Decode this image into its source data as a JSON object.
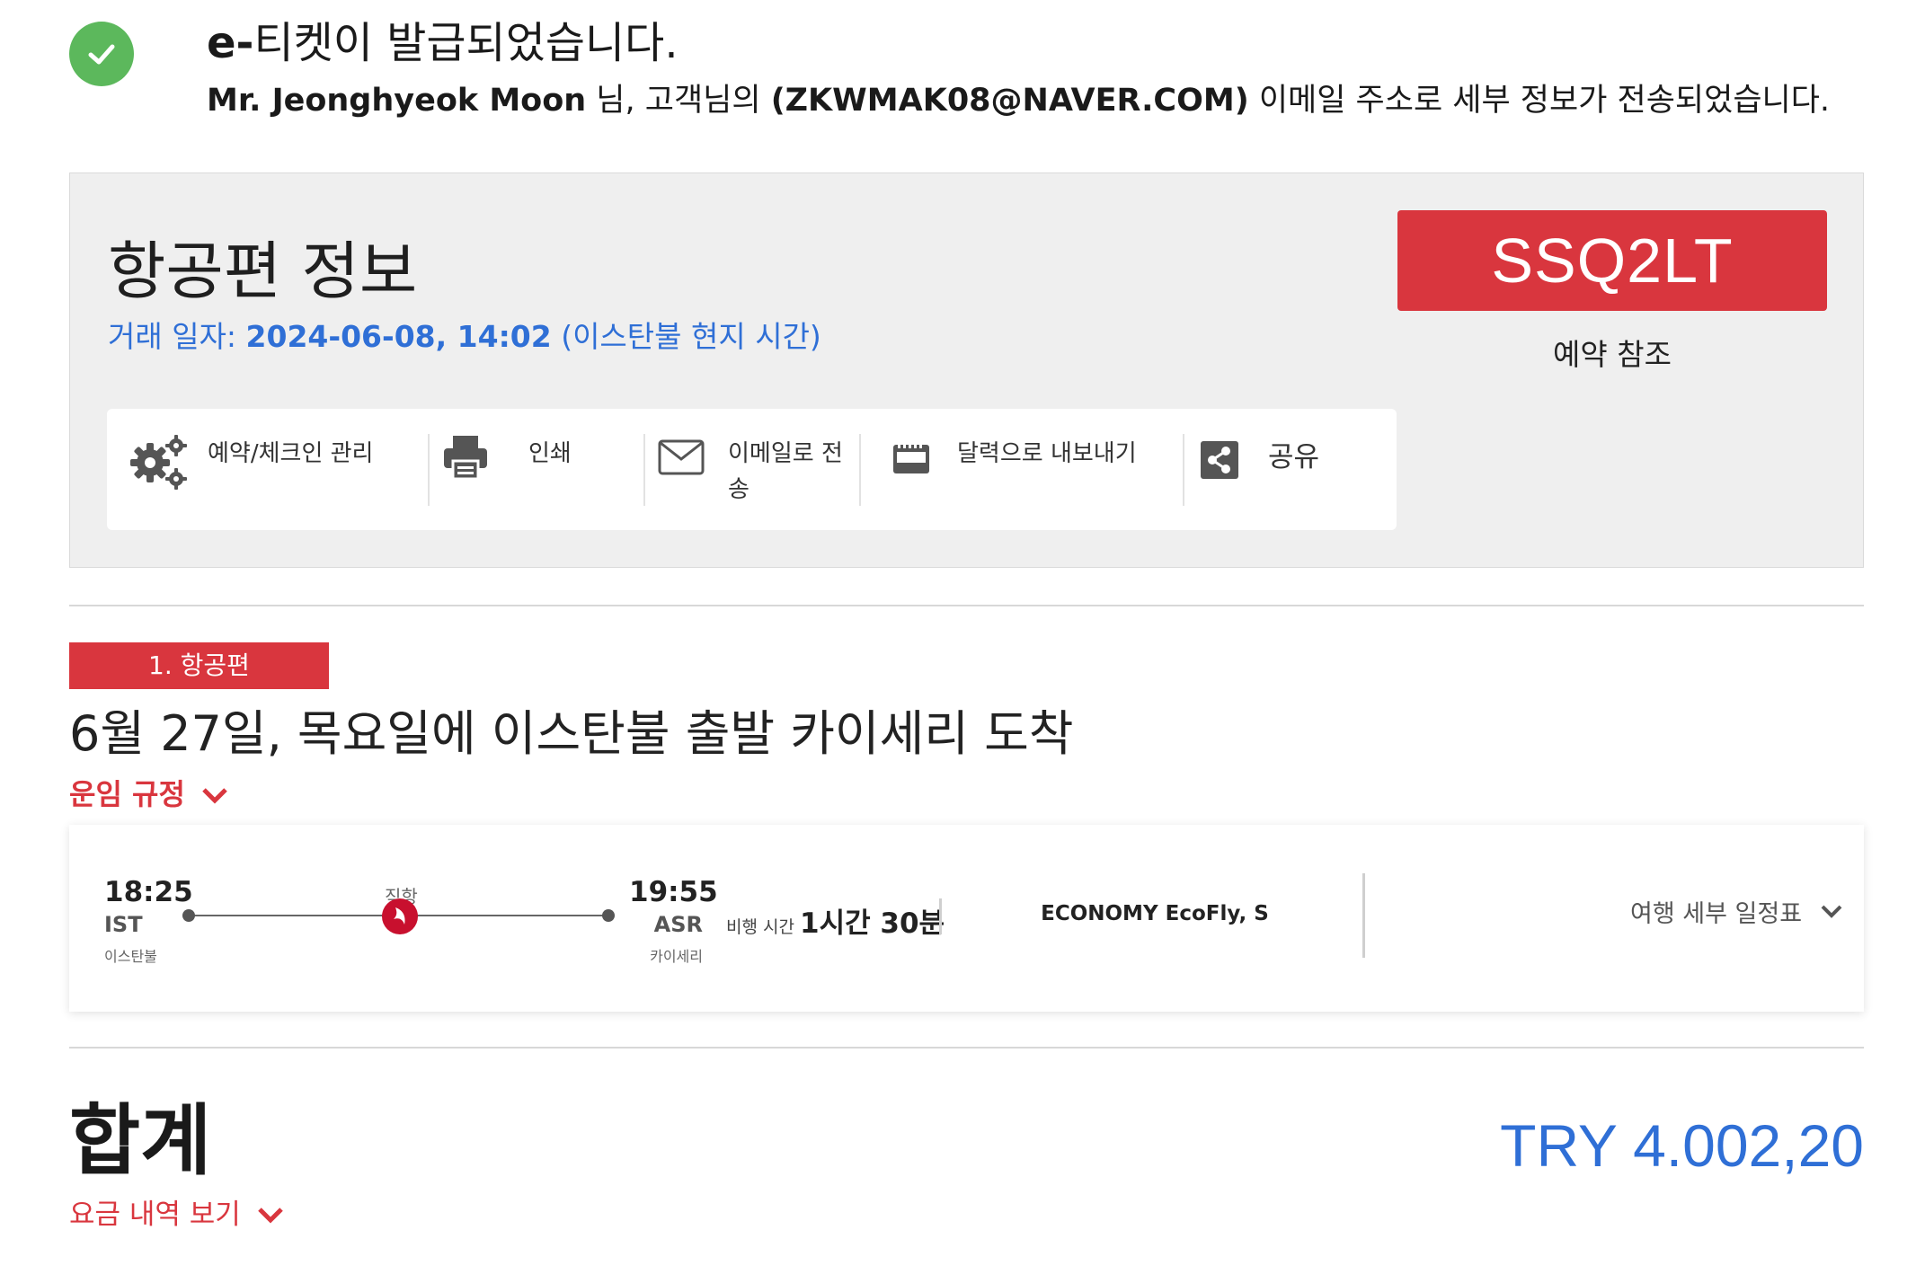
{
  "confirmation": {
    "title_bold": "e-",
    "title_rest": "티켓이 발급되었습니다.",
    "passenger_name": "Mr. Jeonghyeok Moon",
    "msg_mid": " 님, 고객님의 ",
    "email": "(ZKWMAK08@NAVER.COM)",
    "msg_end": " 이메일 주소로 세부 정보가 전송되었습니다."
  },
  "flight_info": {
    "title": "항공편 정보",
    "trans_label": "거래 일자: ",
    "trans_datetime": "2024-06-08, 14:02",
    "trans_tz": " (이스탄불 현지 시간)",
    "pnr": "SSQ2LT",
    "pnr_label": "예약 참조"
  },
  "actions": {
    "manage": "예약/체크인 관리",
    "print": "인쇄",
    "email": "이메일로 전 송",
    "calendar": "달력으로 내보내기",
    "share": "공유"
  },
  "segment": {
    "badge": "1. 항공편",
    "route_title": "6월 27일, 목요일에 이스탄불 출발 카이세리 도착",
    "fare_rules": "운임 규정",
    "dep_time": "18:25",
    "dep_code": "IST",
    "dep_city": "이스탄불",
    "direct": "직항",
    "arr_time": "19:55",
    "arr_code": "ASR",
    "arr_city": "카이세리",
    "duration_label": "비행 시간 ",
    "duration_value": "1시간 30분",
    "cabin": "ECONOMY EcoFly, S",
    "itinerary": "여행 세부 일정표"
  },
  "total": {
    "label": "합계",
    "amount": "TRY 4.002,20",
    "price_detail": "요금 내역 보기"
  },
  "colors": {
    "brand_red": "#d9363e",
    "link_blue": "#2f6fd6",
    "success_green": "#5cb85c"
  }
}
